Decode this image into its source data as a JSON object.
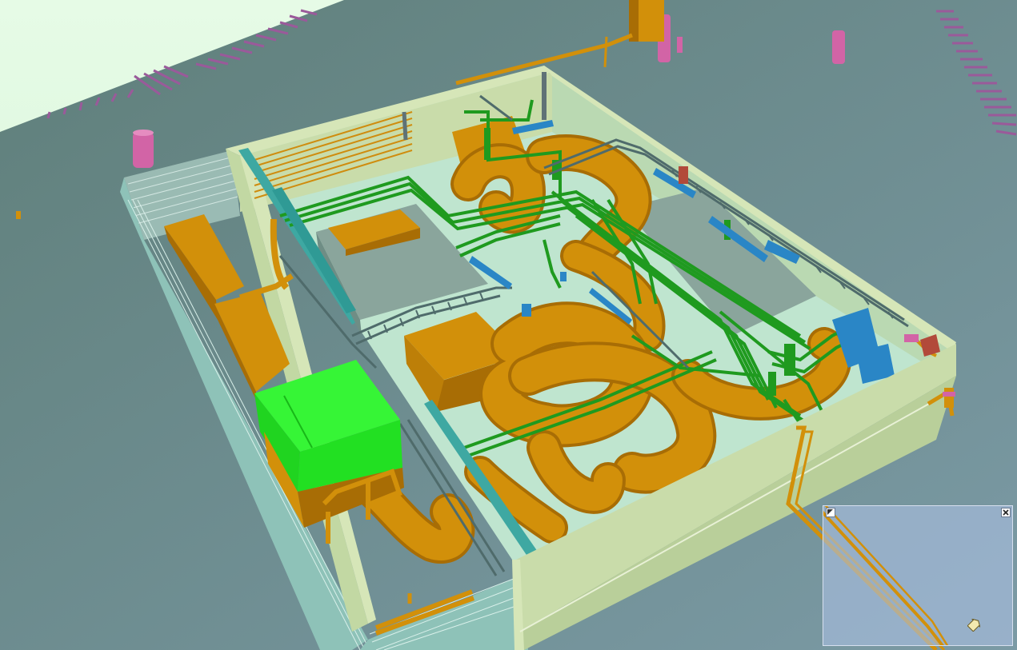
{
  "app": {
    "view": "3d-plant-model",
    "colors": {
      "sky": "#dcf7dc",
      "floor": "#6f9096",
      "wall": "#c9dcaa",
      "wall_dark": "#a7bf8a",
      "duct": "#d2900a",
      "duct_dark": "#a86d05",
      "green_pipe": "#1f9a1f",
      "selected_equipment": "#22e022",
      "blue_equipment": "#2a86c6",
      "magenta_vent": "#d264a6",
      "cable_tray": "#4f6b6b",
      "teal_rail": "#3ea8a2"
    }
  },
  "navigator": {
    "expand_icon": "corner-arrow-icon",
    "close_icon": "close-icon",
    "cursor_icon": "pointer-cursor-icon"
  }
}
